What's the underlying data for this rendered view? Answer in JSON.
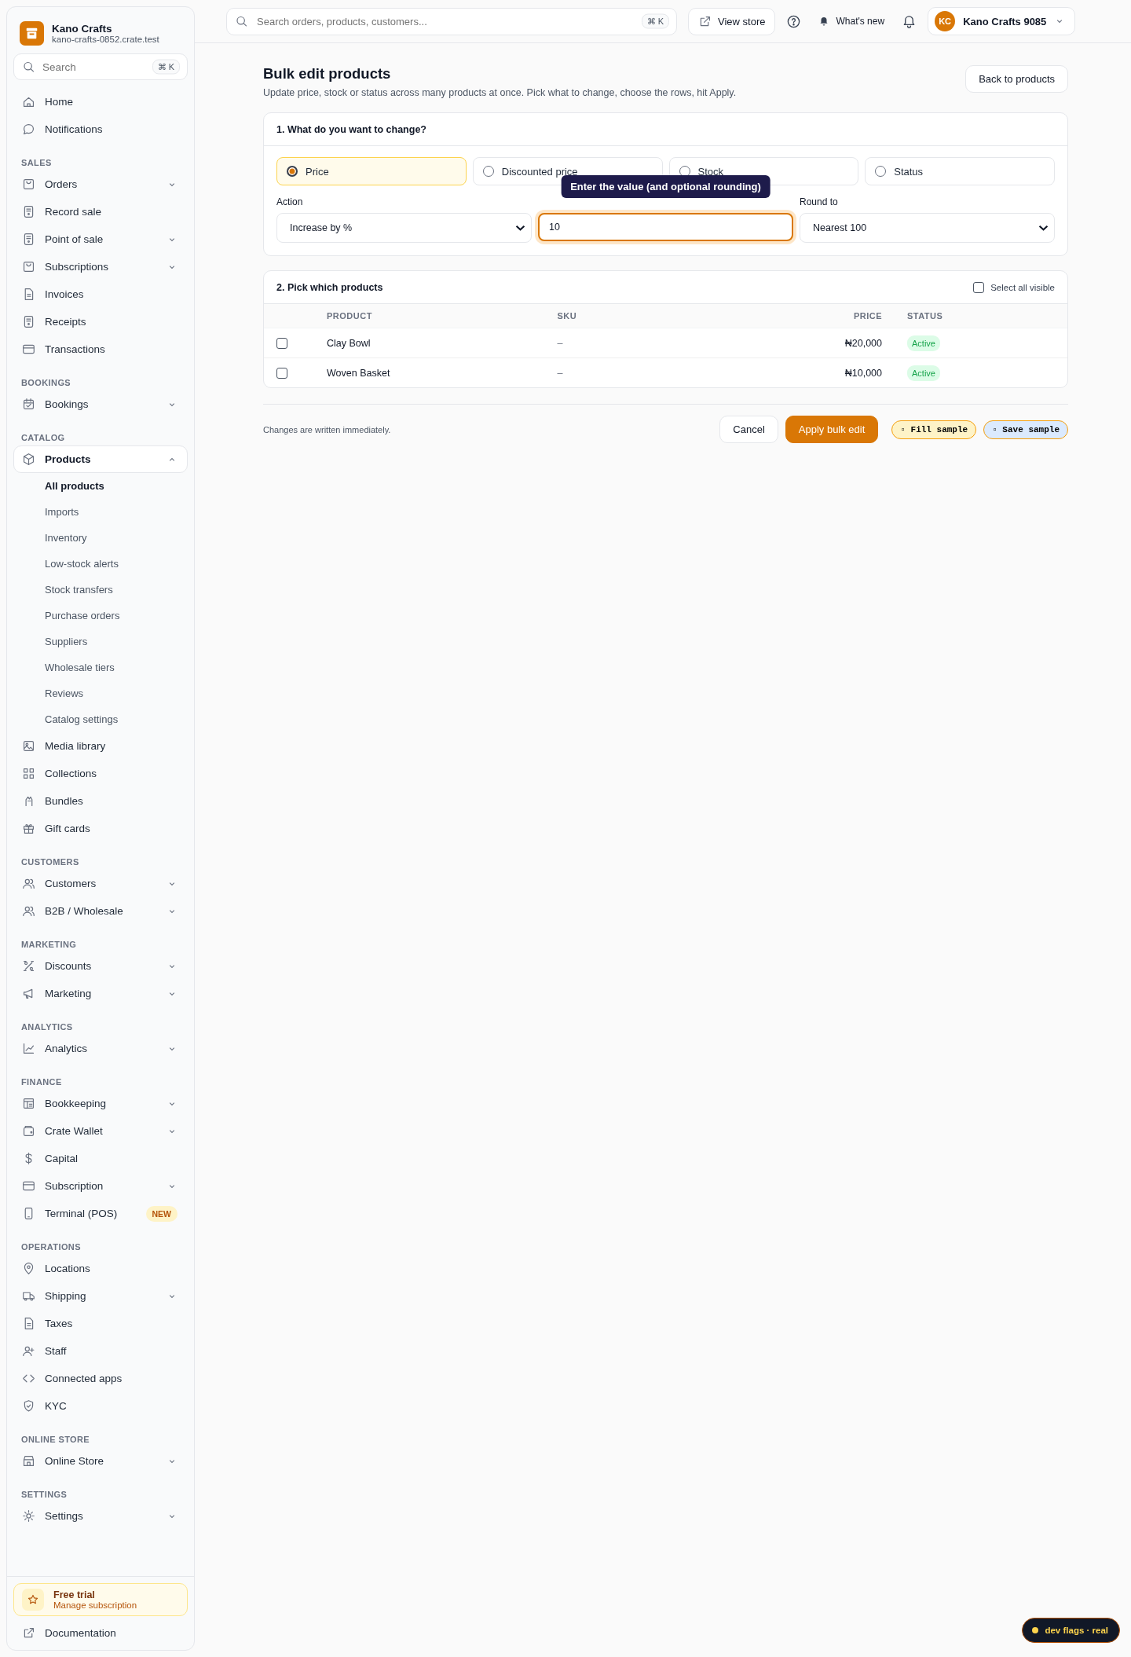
{
  "brand": {
    "name": "Kano Crafts",
    "domain": "kano-crafts-0852.crate.test"
  },
  "sidebar": {
    "search": {
      "placeholder": "Search",
      "shortcut": "⌘ K"
    },
    "sections": [
      {
        "items": [
          {
            "label": "Home",
            "selected": false
          },
          {
            "label": "Notifications",
            "selected": false
          }
        ]
      },
      {
        "heading": "SALES",
        "items": [
          {
            "label": "Orders",
            "selected": false,
            "expanded": false
          },
          {
            "label": "Record sale",
            "selected": false
          },
          {
            "label": "Point of sale",
            "selected": false,
            "expanded": false
          },
          {
            "label": "Subscriptions",
            "selected": false,
            "expanded": false
          },
          {
            "label": "Invoices",
            "selected": false
          },
          {
            "label": "Receipts",
            "selected": false
          },
          {
            "label": "Transactions",
            "selected": false
          }
        ]
      },
      {
        "heading": "BOOKINGS",
        "items": [
          {
            "label": "Bookings",
            "selected": false,
            "expanded": false
          }
        ]
      },
      {
        "heading": "CATALOG",
        "items": [
          {
            "label": "Products",
            "selected": true,
            "expanded": true,
            "children": [
              {
                "label": "All products",
                "selected": true
              },
              {
                "label": "Imports",
                "selected": false
              },
              {
                "label": "Inventory",
                "selected": false
              },
              {
                "label": "Low-stock alerts",
                "selected": false
              },
              {
                "label": "Stock transfers",
                "selected": false
              },
              {
                "label": "Purchase orders",
                "selected": false
              },
              {
                "label": "Suppliers",
                "selected": false
              },
              {
                "label": "Wholesale tiers",
                "selected": false
              },
              {
                "label": "Reviews",
                "selected": false
              },
              {
                "label": "Catalog settings",
                "selected": false
              }
            ]
          },
          {
            "label": "Media library",
            "selected": false
          },
          {
            "label": "Collections",
            "selected": false
          },
          {
            "label": "Bundles",
            "selected": false
          },
          {
            "label": "Gift cards",
            "selected": false
          }
        ]
      },
      {
        "heading": "CUSTOMERS",
        "items": [
          {
            "label": "Customers",
            "selected": false,
            "expanded": false
          },
          {
            "label": "B2B / Wholesale",
            "selected": false,
            "expanded": false
          }
        ]
      },
      {
        "heading": "MARKETING",
        "items": [
          {
            "label": "Discounts",
            "selected": false,
            "expanded": false
          },
          {
            "label": "Marketing",
            "selected": false,
            "expanded": false
          }
        ]
      },
      {
        "heading": "ANALYTICS",
        "items": [
          {
            "label": "Analytics",
            "selected": false,
            "expanded": false
          }
        ]
      },
      {
        "heading": "FINANCE",
        "items": [
          {
            "label": "Bookkeeping",
            "selected": false,
            "expanded": false
          },
          {
            "label": "Crate Wallet",
            "selected": false,
            "expanded": false
          },
          {
            "label": "Capital",
            "selected": false
          },
          {
            "label": "Subscription",
            "selected": false,
            "expanded": false
          },
          {
            "label": "Terminal (POS)",
            "selected": false,
            "badge": "NEW"
          }
        ]
      },
      {
        "heading": "OPERATIONS",
        "items": [
          {
            "label": "Locations",
            "selected": false
          },
          {
            "label": "Shipping",
            "selected": false,
            "expanded": false
          },
          {
            "label": "Taxes",
            "selected": false
          },
          {
            "label": "Staff",
            "selected": false
          },
          {
            "label": "Connected apps",
            "selected": false
          },
          {
            "label": "KYC",
            "selected": false
          }
        ]
      },
      {
        "heading": "ONLINE STORE",
        "items": [
          {
            "label": "Online Store",
            "selected": false,
            "expanded": false
          }
        ]
      },
      {
        "heading": "SETTINGS",
        "items": [
          {
            "label": "Settings",
            "selected": false,
            "expanded": false
          }
        ]
      }
    ],
    "trial": {
      "title": "Free trial",
      "subtitle": "Manage subscription"
    },
    "documentation": "Documentation"
  },
  "topbar": {
    "search": {
      "placeholder": "Search orders, products, customers...",
      "shortcut": "⌘ K"
    },
    "view_store": "View store",
    "whats_new": "What's new",
    "account": {
      "initials": "KC",
      "name": "Kano Crafts 9085"
    }
  },
  "page": {
    "title": "Bulk edit products",
    "subtitle": "Update price, stock or status across many products at once. Pick what to change, choose the rows, hit Apply.",
    "back": "Back to products"
  },
  "change_card": {
    "title": "1. What do you want to change?",
    "options": [
      {
        "label": "Price",
        "selected": true
      },
      {
        "label": "Discounted price",
        "selected": false
      },
      {
        "label": "Stock",
        "selected": false
      },
      {
        "label": "Status",
        "selected": false
      }
    ],
    "action": {
      "label": "Action",
      "value": "Increase by %"
    },
    "value": {
      "value": "10",
      "tooltip": "Enter the value (and optional rounding)"
    },
    "round": {
      "label": "Round to",
      "value": "Nearest 100"
    }
  },
  "products_card": {
    "title": "2. Pick which products",
    "select_all": {
      "label": "Select all visible",
      "checked": false
    },
    "columns": [
      "PRODUCT",
      "SKU",
      "PRICE",
      "STATUS"
    ],
    "rows": [
      {
        "product": "Clay Bowl",
        "sku": "–",
        "price": "₦20,000",
        "status": "Active",
        "checked": false
      },
      {
        "product": "Woven Basket",
        "sku": "–",
        "price": "₦10,000",
        "status": "Active",
        "checked": false
      }
    ]
  },
  "footer": {
    "note": "Changes are written immediately.",
    "cancel": "Cancel",
    "apply": "Apply bulk edit",
    "fill_sample": "▫ Fill sample",
    "save_sample": "▫ Save sample"
  },
  "dev_badge": "dev flags · real"
}
